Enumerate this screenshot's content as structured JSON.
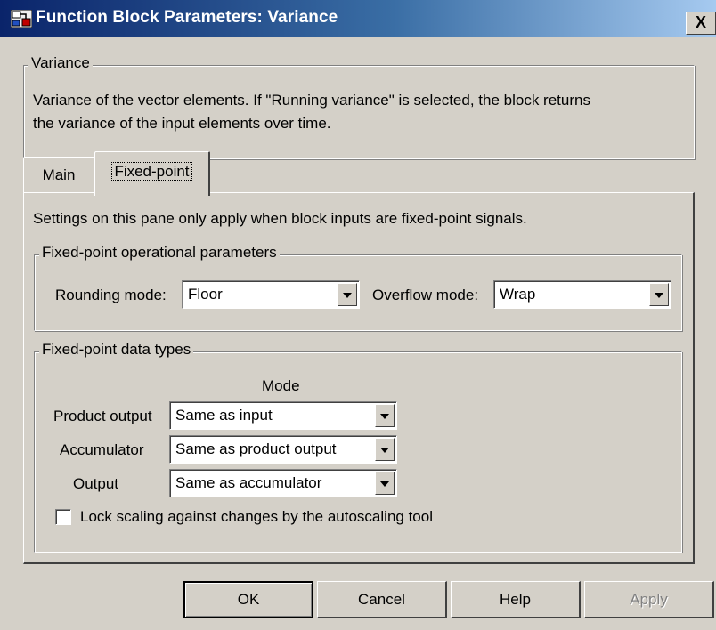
{
  "window": {
    "title": "Function Block Parameters: Variance",
    "close_label": "X"
  },
  "description_group": {
    "label": "Variance",
    "text_line1": "Variance of the vector elements. If \"Running variance\" is selected, the block returns",
    "text_line2": "the variance of the input elements over time."
  },
  "tabs": [
    {
      "label": "Main",
      "selected": false
    },
    {
      "label": "Fixed-point",
      "selected": true
    }
  ],
  "panel": {
    "intro": "Settings on this pane only apply when block inputs are fixed-point signals."
  },
  "operational_params": {
    "label": "Fixed-point operational parameters",
    "rounding_label": "Rounding mode:",
    "rounding_value": "Floor",
    "overflow_label": "Overflow mode:",
    "overflow_value": "Wrap"
  },
  "data_types": {
    "label": "Fixed-point data types",
    "mode_header": "Mode",
    "rows": [
      {
        "label": "Product output",
        "value": "Same as input"
      },
      {
        "label": "Accumulator",
        "value": "Same as product output"
      },
      {
        "label": "Output",
        "value": "Same as accumulator"
      }
    ],
    "lock_label": "Lock scaling against changes by the autoscaling tool",
    "lock_checked": false
  },
  "buttons": {
    "ok": "OK",
    "cancel": "Cancel",
    "help": "Help",
    "apply": "Apply"
  },
  "colors": {
    "titlebar_start": "#0a246a",
    "titlebar_end": "#a6caf0",
    "dialog_bg": "#d4d0c8"
  }
}
